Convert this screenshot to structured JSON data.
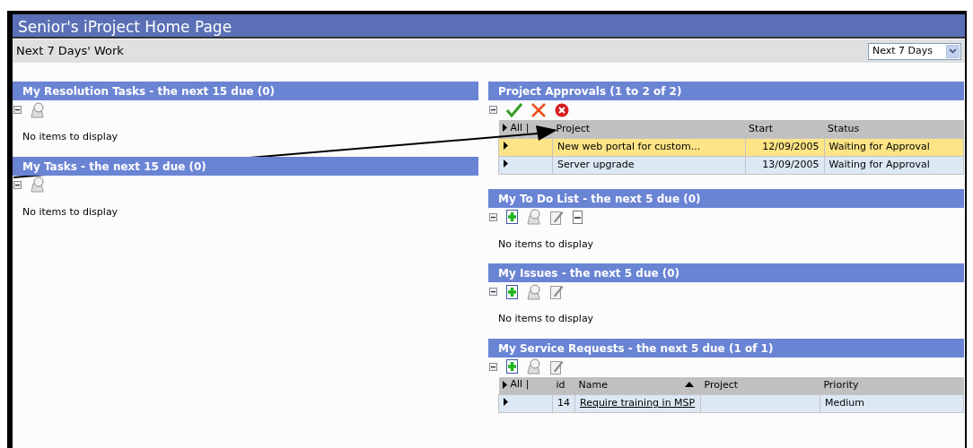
{
  "title": "Senior's iProject Home Page",
  "subheader": {
    "label": "Next 7 Days' Work",
    "period": "Next 7 Days"
  },
  "left_panels": [
    {
      "title": "My Resolution Tasks - the next 15 due (0)",
      "tools": [
        {
          "kind": "collapse"
        },
        {
          "kind": "find"
        }
      ],
      "empty_text": "No items to display"
    },
    {
      "title": "My Tasks - the next 15 due (0)",
      "tools": [
        {
          "kind": "collapse"
        },
        {
          "kind": "find"
        }
      ],
      "empty_text": "No items to display"
    }
  ],
  "right_panels": [
    {
      "title": "Project Approvals (1 to 2 of 2)",
      "tools": [
        {
          "kind": "collapse"
        },
        {
          "kind": "approve"
        },
        {
          "kind": "reject"
        },
        {
          "kind": "cancel"
        }
      ],
      "table": {
        "columns": [
          {
            "label": "All |",
            "kind": "expander"
          },
          {
            "label": "Project",
            "kind": "text"
          },
          {
            "label": "Start",
            "kind": "date"
          },
          {
            "label": "Status",
            "kind": "text"
          }
        ],
        "rows": [
          {
            "selected": true,
            "cells": [
              null,
              "New web portal for custom...",
              "12/09/2005",
              "Waiting for Approval"
            ]
          },
          {
            "selected": false,
            "cells": [
              null,
              "Server upgrade",
              "13/09/2005",
              "Waiting for Approval"
            ]
          }
        ]
      }
    },
    {
      "title": "My To Do List - the next 5 due (0)",
      "tools": [
        {
          "kind": "collapse"
        },
        {
          "kind": "add"
        },
        {
          "kind": "find"
        },
        {
          "kind": "edit"
        },
        {
          "kind": "delete"
        }
      ],
      "empty_text": "No items to display"
    },
    {
      "title": "My Issues - the next 5 due (0)",
      "tools": [
        {
          "kind": "collapse"
        },
        {
          "kind": "add"
        },
        {
          "kind": "find"
        },
        {
          "kind": "edit"
        }
      ],
      "empty_text": "No items to display"
    },
    {
      "title": "My Service Requests - the next 5 due (1 of 1)",
      "tools": [
        {
          "kind": "collapse"
        },
        {
          "kind": "add"
        },
        {
          "kind": "find"
        },
        {
          "kind": "edit"
        }
      ],
      "table": {
        "columns": [
          {
            "label": "All |",
            "kind": "expander"
          },
          {
            "label": "id",
            "kind": "number"
          },
          {
            "label": "Name",
            "kind": "link",
            "sorted": true
          },
          {
            "label": "Project",
            "kind": "text"
          },
          {
            "label": "Priority",
            "kind": "text"
          }
        ],
        "rows": [
          {
            "selected": false,
            "cells": [
              null,
              "14",
              "Require training in MSP",
              null,
              "Medium"
            ]
          }
        ]
      }
    }
  ]
}
